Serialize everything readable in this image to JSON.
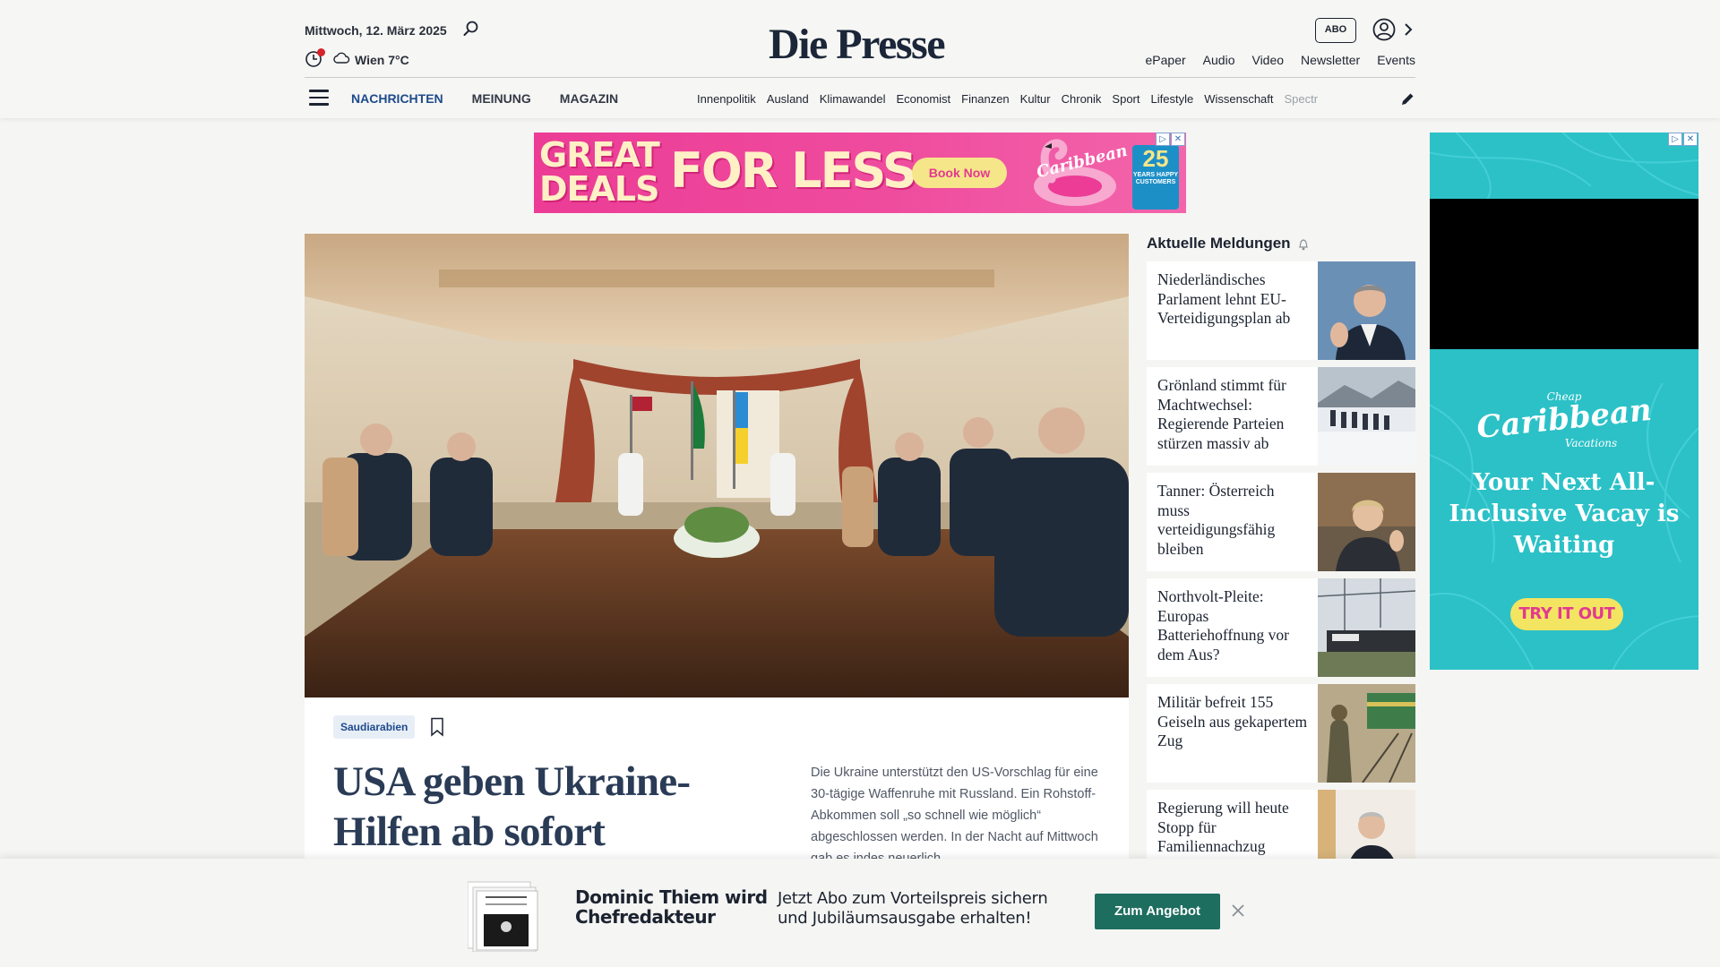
{
  "header": {
    "date": "Mittwoch, 12. März 2025",
    "weather": "Wien 7°C",
    "logo": "Die Presse",
    "abo_label": "ABO",
    "top_links": [
      "ePaper",
      "Audio",
      "Video",
      "Newsletter",
      "Events"
    ],
    "main_nav": [
      "NACHRICHTEN",
      "MEINUNG",
      "MAGAZIN"
    ],
    "sub_nav": [
      "Innenpolitik",
      "Ausland",
      "Klimawandel",
      "Economist",
      "Finanzen",
      "Kultur",
      "Chronik",
      "Sport",
      "Lifestyle",
      "Wissenschaft",
      "Spectr"
    ]
  },
  "ad_banner": {
    "headline_1": "GREAT",
    "headline_2": "DEALS",
    "headline_3": "FOR LESS",
    "button": "Book Now",
    "brand": "Caribbean",
    "badge_number": "25",
    "badge_text": "YEARS HAPPY CUSTOMERS"
  },
  "ad_side": {
    "brand_small": "Cheap",
    "brand": "Caribbean",
    "brand_sub": "Vacations",
    "tagline": "Your Next All-Inclusive Vacay is Waiting",
    "cta": "TRY IT OUT"
  },
  "hero": {
    "tag": "Saudiarabien",
    "title": "USA geben Ukraine-Hilfen ab sofort",
    "lead": "Die Ukraine unterstützt den US-Vorschlag für eine 30-tägige Waffenruhe mit Russland. Ein Rohstoff-Abkommen soll „so schnell wie möglich“ abgeschlossen werden. In der Nacht auf Mittwoch gab es indes neuerlich"
  },
  "news": {
    "heading": "Aktuelle Meldungen",
    "items": [
      {
        "title": "Niederländisches Parlament lehnt EU-Verteidigungsplan ab"
      },
      {
        "title": "Grönland stimmt für Machtwechsel: Regierende Parteien stürzen massiv ab"
      },
      {
        "title": "Tanner: Österreich muss verteidigungsfähig bleiben"
      },
      {
        "title": "Northvolt-Pleite: Europas Batteriehoffnung vor dem Aus?"
      },
      {
        "title": "Militär befreit 155 Geiseln aus gekapertem Zug"
      },
      {
        "title": "Regierung will heute Stopp für Familiennachzug"
      }
    ]
  },
  "promo": {
    "headline": "Dominic Thiem wird Chefredakteur",
    "text": "Jetzt Abo zum Vorteilspreis sichern und Jubiläumsausgabe erhalten!",
    "cta": "Zum Angebot",
    "paper_logo": "Die Presse"
  },
  "colors": {
    "accent_blue": "#1e4a8c",
    "promo_green": "#1e6e60",
    "ad_pink": "#ec3c96",
    "ad_teal": "#2bc1c7"
  }
}
